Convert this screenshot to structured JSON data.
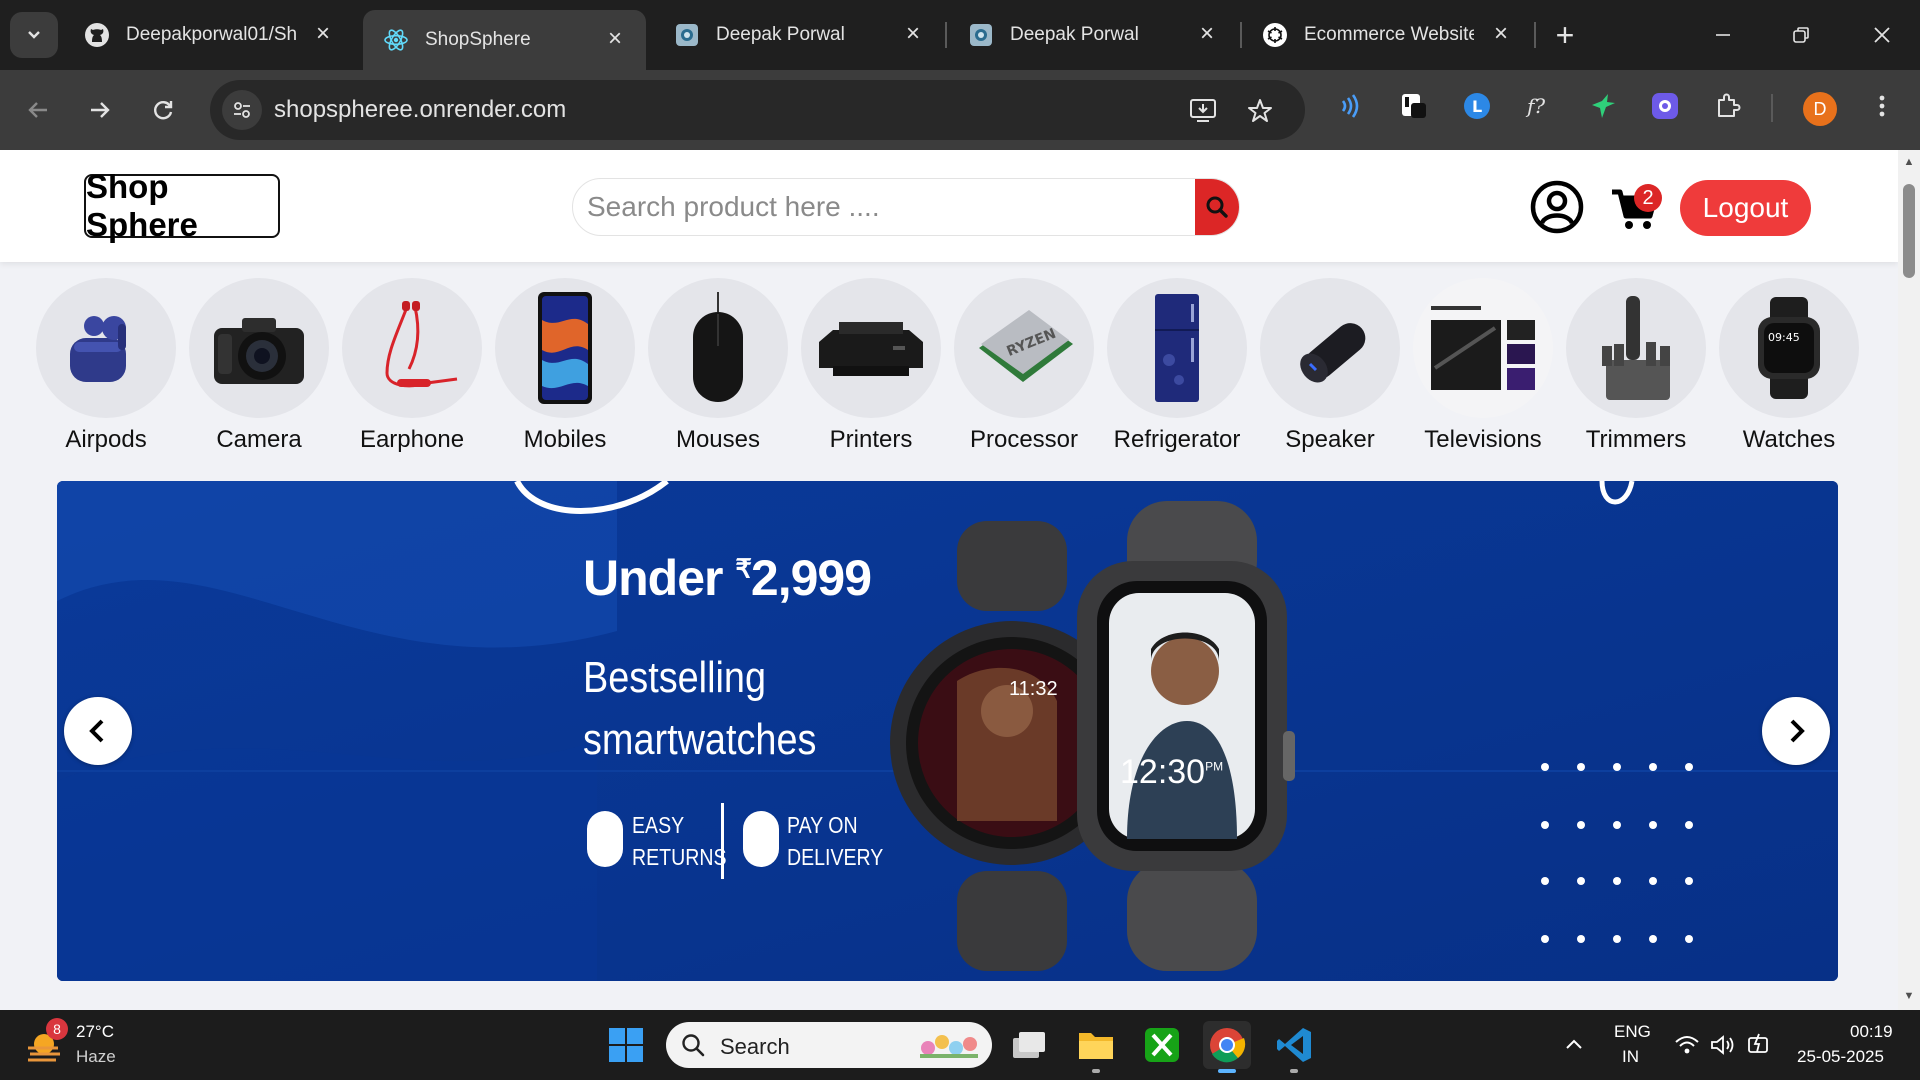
{
  "browser": {
    "tabs": [
      {
        "title": "Deepakporwal01/Sh",
        "icon": "github-icon",
        "active": false
      },
      {
        "title": "ShopSphere",
        "icon": "react-icon",
        "active": true
      },
      {
        "title": "Deepak Porwal",
        "icon": "page-icon",
        "active": false
      },
      {
        "title": "Deepak Porwal",
        "icon": "page-icon",
        "active": false
      },
      {
        "title": "Ecommerce Website",
        "icon": "openai-icon",
        "active": false
      }
    ],
    "url": "shopspheree.onrender.com",
    "profile_initial": "D",
    "profile_color": "#e8711b"
  },
  "site": {
    "logo": "Shop Sphere",
    "search_placeholder": "Search product here ....",
    "cart_count": "2",
    "logout_label": "Logout",
    "accent_color": "#dc2626"
  },
  "categories": [
    {
      "label": "Airpods",
      "icon": "airpods-icon"
    },
    {
      "label": "Camera",
      "icon": "camera-icon"
    },
    {
      "label": "Earphone",
      "icon": "earphone-icon"
    },
    {
      "label": "Mobiles",
      "icon": "mobile-icon"
    },
    {
      "label": "Mouses",
      "icon": "mouse-icon"
    },
    {
      "label": "Printers",
      "icon": "printer-icon"
    },
    {
      "label": "Processor",
      "icon": "processor-icon"
    },
    {
      "label": "Refrigerator",
      "icon": "refrigerator-icon"
    },
    {
      "label": "Speaker",
      "icon": "speaker-icon"
    },
    {
      "label": "Televisions",
      "icon": "television-icon"
    },
    {
      "label": "Trimmers",
      "icon": "trimmer-icon"
    },
    {
      "label": "Watches",
      "icon": "watch-icon"
    }
  ],
  "banner": {
    "price_prefix": "Under ",
    "price_symbol": "₹",
    "price_value": "2,999",
    "line1": "Bestselling",
    "line2": "smartwatches",
    "feature1_line1": "EASY",
    "feature1_line2": "RETURNS",
    "feature2_line1": "PAY ON",
    "feature2_line2": "DELIVERY",
    "watch1_time": "11:32",
    "watch2_time": "12:30",
    "watch2_suffix": "PM",
    "bg_color": "#0b3c97"
  },
  "taskbar": {
    "weather_temp": "27°C",
    "weather_desc": "Haze",
    "weather_badge": "8",
    "search_label": "Search",
    "lang1": "ENG",
    "lang2": "IN",
    "time": "00:19",
    "date": "25-05-2025"
  }
}
